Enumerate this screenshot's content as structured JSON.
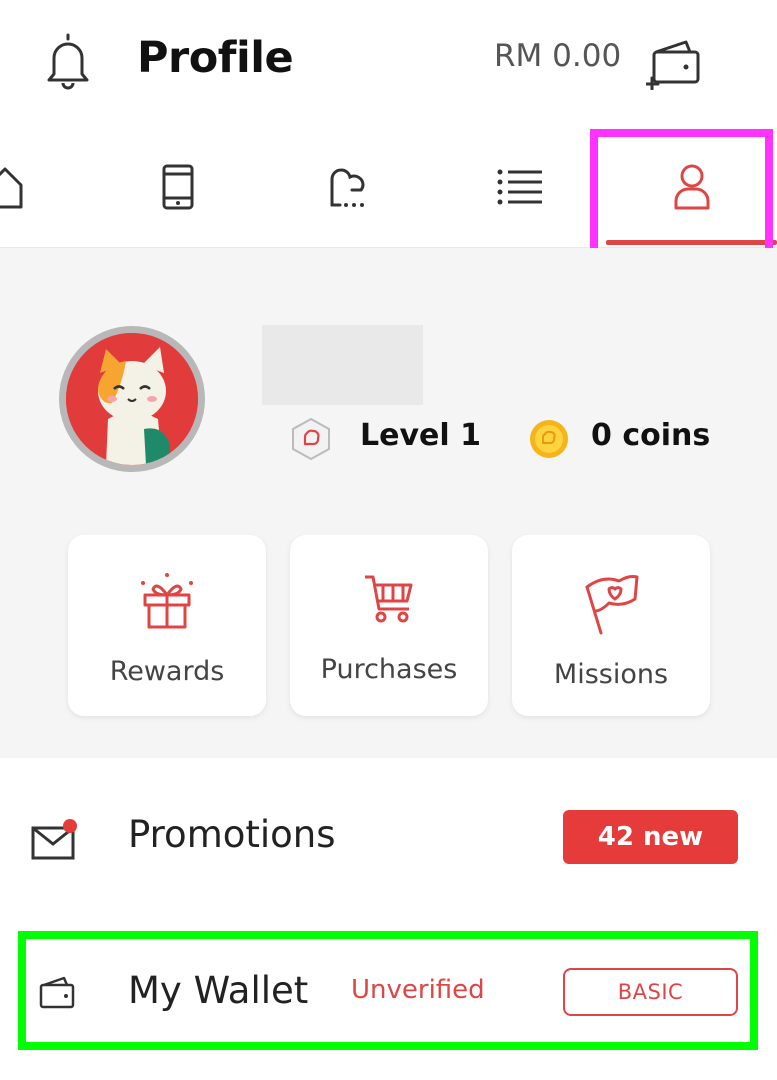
{
  "header": {
    "title": "Profile",
    "balance": "RM 0.00",
    "bell_icon": "bell-icon",
    "topup_icon": "wallet-topup-icon"
  },
  "tabs": [
    {
      "name": "home",
      "icon": "home-icon",
      "active": false
    },
    {
      "name": "mobile",
      "icon": "phone-icon",
      "active": false
    },
    {
      "name": "chat",
      "icon": "chat-icon",
      "active": false
    },
    {
      "name": "list",
      "icon": "list-icon",
      "active": false
    },
    {
      "name": "profile",
      "icon": "user-icon",
      "active": true
    }
  ],
  "profile": {
    "level": "Level 1",
    "coins": "0 coins"
  },
  "cards": [
    {
      "label": "Rewards",
      "icon": "gift-icon"
    },
    {
      "label": "Purchases",
      "icon": "cart-icon"
    },
    {
      "label": "Missions",
      "icon": "flag-icon"
    }
  ],
  "promotions": {
    "label": "Promotions",
    "badge": "42 new",
    "icon": "mail-notification-icon"
  },
  "wallet": {
    "label": "My Wallet",
    "status": "Unverified",
    "tier": "BASIC",
    "icon": "wallet-icon"
  },
  "colors": {
    "accent": "#e04545",
    "highlight_magenta": "#ff33ff",
    "highlight_green": "#00ff00"
  }
}
